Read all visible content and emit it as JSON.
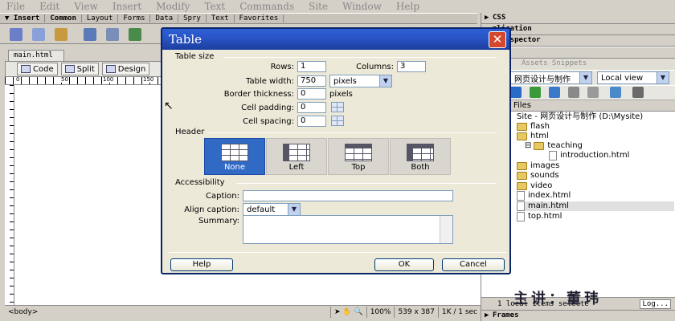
{
  "menu": [
    "File",
    "Edit",
    "View",
    "Insert",
    "Modify",
    "Text",
    "Commands",
    "Site",
    "Window",
    "Help"
  ],
  "insert_bar": {
    "active": "Insert",
    "tabs": [
      "Common",
      "Layout",
      "Forms",
      "Data",
      "Spry",
      "Text",
      "Favorites"
    ]
  },
  "document": {
    "tab": "main.html",
    "views": {
      "code": "Code",
      "split": "Split",
      "design": "Design"
    },
    "ruler_ticks": [
      "0",
      "50",
      "100",
      "150"
    ],
    "status": {
      "tag": "<body>",
      "zoom": "100%",
      "size": "539 x 387",
      "weight": "1K / 1 sec"
    }
  },
  "dialog": {
    "title": "Table",
    "close": "✕",
    "table_size_label": "Table size",
    "rows_label": "Rows:",
    "rows_value": "1",
    "columns_label": "Columns:",
    "columns_value": "3",
    "width_label": "Table width:",
    "width_value": "750",
    "width_unit": "pixels",
    "border_label": "Border thickness:",
    "border_value": "0",
    "border_unit": "pixels",
    "padding_label": "Cell padding:",
    "padding_value": "0",
    "spacing_label": "Cell spacing:",
    "spacing_value": "0",
    "header_label": "Header",
    "header_options": [
      "None",
      "Left",
      "Top",
      "Both"
    ],
    "header_selected": "None",
    "accessibility_label": "Accessibility",
    "caption_label": "Caption:",
    "caption_value": "",
    "align_label": "Align caption:",
    "align_value": "default",
    "summary_label": "Summary:",
    "help": "Help",
    "ok": "OK",
    "cancel": "Cancel"
  },
  "right_panel": {
    "css": "CSS",
    "application": "plication",
    "tag_inspector": "c Inspector",
    "files_head": "es",
    "file_tabs": "Assets  Snippets",
    "site_select": "网页设计与制作",
    "view_select": "Local view",
    "files_label": "Files",
    "tree": [
      {
        "label": "Site - 网页设计与制作 (D:\\Mysite)",
        "type": "site"
      },
      {
        "label": "flash",
        "type": "folder"
      },
      {
        "label": "html",
        "type": "folder"
      },
      {
        "label": "teaching",
        "type": "folder"
      },
      {
        "label": "introduction.html",
        "type": "file"
      },
      {
        "label": "images",
        "type": "folder"
      },
      {
        "label": "sounds",
        "type": "folder"
      },
      {
        "label": "video",
        "type": "folder"
      },
      {
        "label": "index.html",
        "type": "file"
      },
      {
        "label": "main.html",
        "type": "file"
      },
      {
        "label": "top.html",
        "type": "file"
      }
    ],
    "overlay": "主讲：董玮",
    "status": "1 local items selecte",
    "log": "Log...",
    "frames": "Frames"
  }
}
